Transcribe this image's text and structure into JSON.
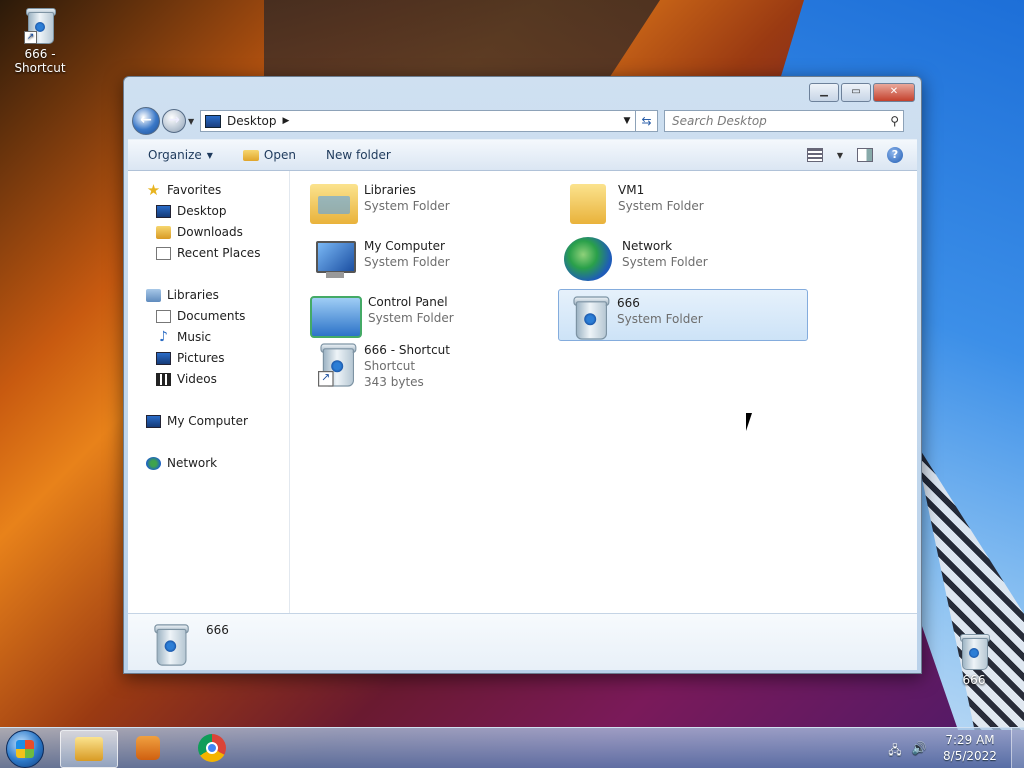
{
  "desktop": {
    "icons": [
      {
        "label": "666 - Shortcut"
      },
      {
        "label": "666"
      }
    ]
  },
  "window": {
    "address": {
      "location": "Desktop"
    },
    "search": {
      "placeholder": "Search Desktop"
    },
    "toolbar": {
      "organize": "Organize",
      "open": "Open",
      "new_folder": "New folder"
    },
    "nav": {
      "favorites": "Favorites",
      "favorites_items": [
        "Desktop",
        "Downloads",
        "Recent Places"
      ],
      "libraries": "Libraries",
      "libraries_items": [
        "Documents",
        "Music",
        "Pictures",
        "Videos"
      ],
      "computer": "My Computer",
      "network": "Network"
    },
    "items": [
      {
        "name": "Libraries",
        "type": "System Folder",
        "icon": "libraries-icon"
      },
      {
        "name": "VM1",
        "type": "System Folder",
        "icon": "user-folder-icon"
      },
      {
        "name": "My Computer",
        "type": "System Folder",
        "icon": "computer-icon"
      },
      {
        "name": "Network",
        "type": "System Folder",
        "icon": "network-icon"
      },
      {
        "name": "Control Panel",
        "type": "System Folder",
        "icon": "control-panel-icon"
      },
      {
        "name": "666",
        "type": "System Folder",
        "icon": "recycle-bin-icon",
        "selected": true
      },
      {
        "name": "666 - Shortcut",
        "type": "Shortcut",
        "size": "343 bytes",
        "icon": "recycle-bin-shortcut-icon"
      }
    ],
    "details": {
      "name": "666"
    }
  },
  "taskbar": {
    "clock": {
      "time": "7:29 AM",
      "date": "8/5/2022"
    }
  }
}
